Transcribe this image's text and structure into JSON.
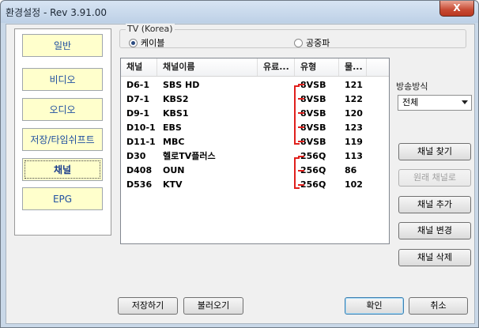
{
  "window": {
    "title": "환경설정 - Rev  3.91.00",
    "close_label": "X"
  },
  "sidebar": {
    "items": [
      {
        "label": "일반",
        "selected": false
      },
      {
        "label": "비디오",
        "selected": false
      },
      {
        "label": "오디오",
        "selected": false
      },
      {
        "label": "저장/타임쉬프트",
        "selected": false
      },
      {
        "label": "채널",
        "selected": true
      },
      {
        "label": "EPG",
        "selected": false
      }
    ]
  },
  "source_group": {
    "label": "TV (Korea)",
    "cable_label": "케이블",
    "air_label": "공중파",
    "selected": "cable"
  },
  "channel_table": {
    "headers": [
      "채널",
      "채널이름",
      "유료...",
      "유형",
      "물..."
    ],
    "rows": [
      [
        "D6-1",
        "SBS HD",
        "",
        "8VSB",
        "121"
      ],
      [
        "D7-1",
        "KBS2",
        "",
        "8VSB",
        "122"
      ],
      [
        "D9-1",
        "KBS1",
        "",
        "8VSB",
        "120"
      ],
      [
        "D10-1",
        "EBS",
        "",
        "8VSB",
        "123"
      ],
      [
        "D11-1",
        "MBC",
        "",
        "8VSB",
        "119"
      ],
      [
        "D30",
        "헬로TV플러스",
        "",
        "256Q",
        "113"
      ],
      [
        "D408",
        "OUN",
        "",
        "256Q",
        "86"
      ],
      [
        "D536",
        "KTV",
        "",
        "256Q",
        "102"
      ]
    ]
  },
  "broadcast": {
    "label": "방송방식",
    "value": "전체"
  },
  "actions": {
    "find": "채널 찾기",
    "restore": "원래 채널로",
    "add": "채널 추가",
    "change": "채널 변경",
    "delete": "채널 삭제"
  },
  "footer": {
    "save": "저장하기",
    "load": "불러오기",
    "ok": "확인",
    "cancel": "취소"
  },
  "colors": {
    "nav_bg": "#ffffcc",
    "annotation": "#e0201c",
    "window_frame": "#c9d8e8"
  }
}
